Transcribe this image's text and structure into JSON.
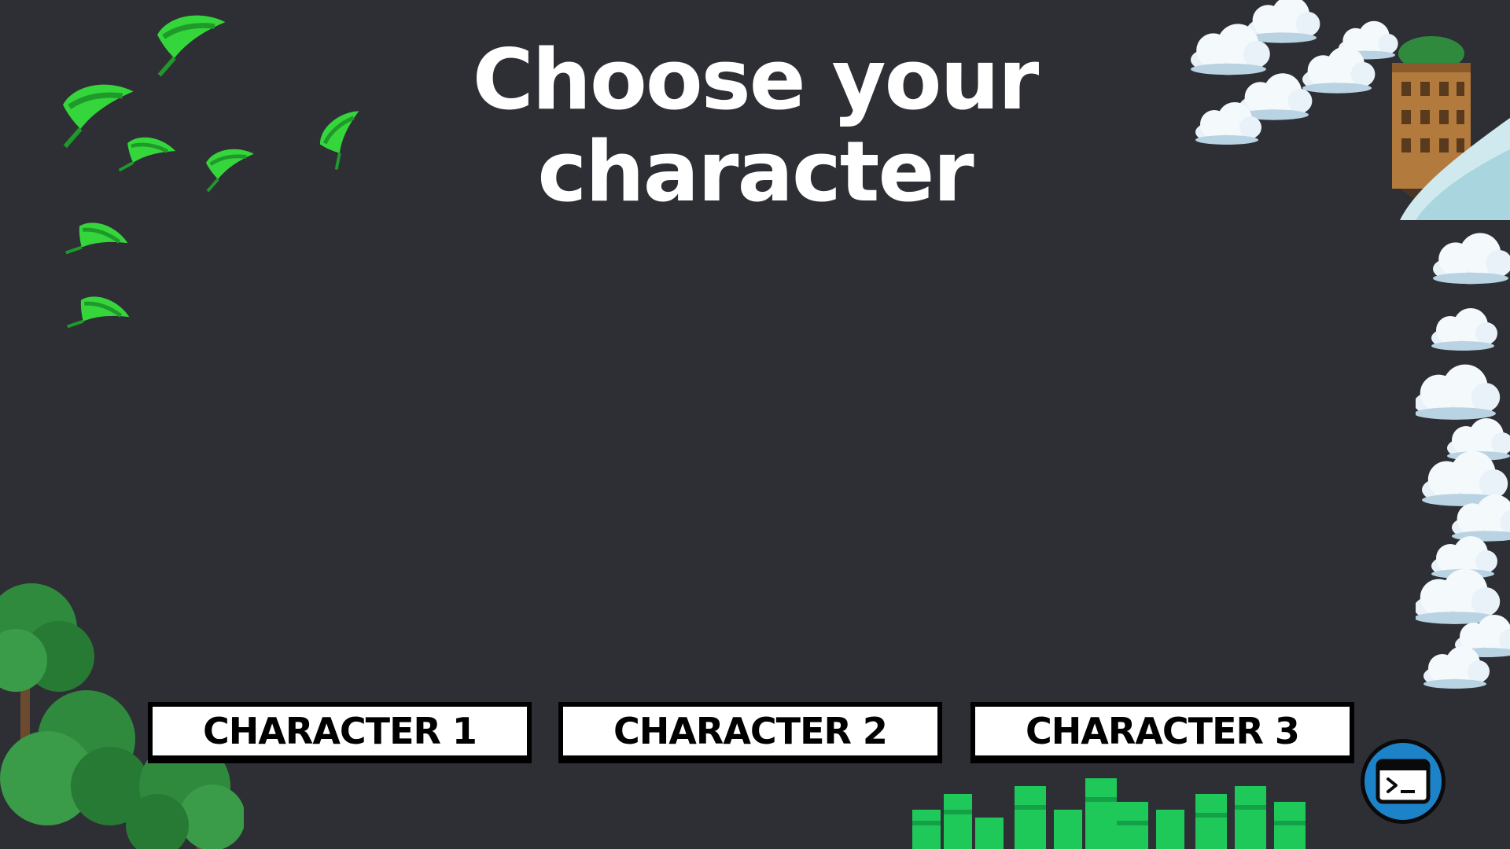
{
  "screen": {
    "title": "Choose your character"
  },
  "buttons": {
    "character_1": "CHARACTER 1",
    "character_2": "CHARACTER 2",
    "character_3": "CHARACTER 3"
  },
  "icons": {
    "terminal": "terminal-icon",
    "leaf": "leaf-icon",
    "tree": "tree-icon",
    "cloud": "cloud-icon",
    "castle": "floating-castle-icon",
    "bamboo": "bamboo-icon"
  },
  "colors": {
    "background": "#2e2f35",
    "title": "#ffffff",
    "button_bg": "#ffffff",
    "button_border": "#000000",
    "terminal_button": "#1d83c9",
    "leaf": "#35d63c",
    "tree": "#2f8a3e",
    "bamboo": "#1ec95a",
    "cloud": "#e8f2f8"
  }
}
